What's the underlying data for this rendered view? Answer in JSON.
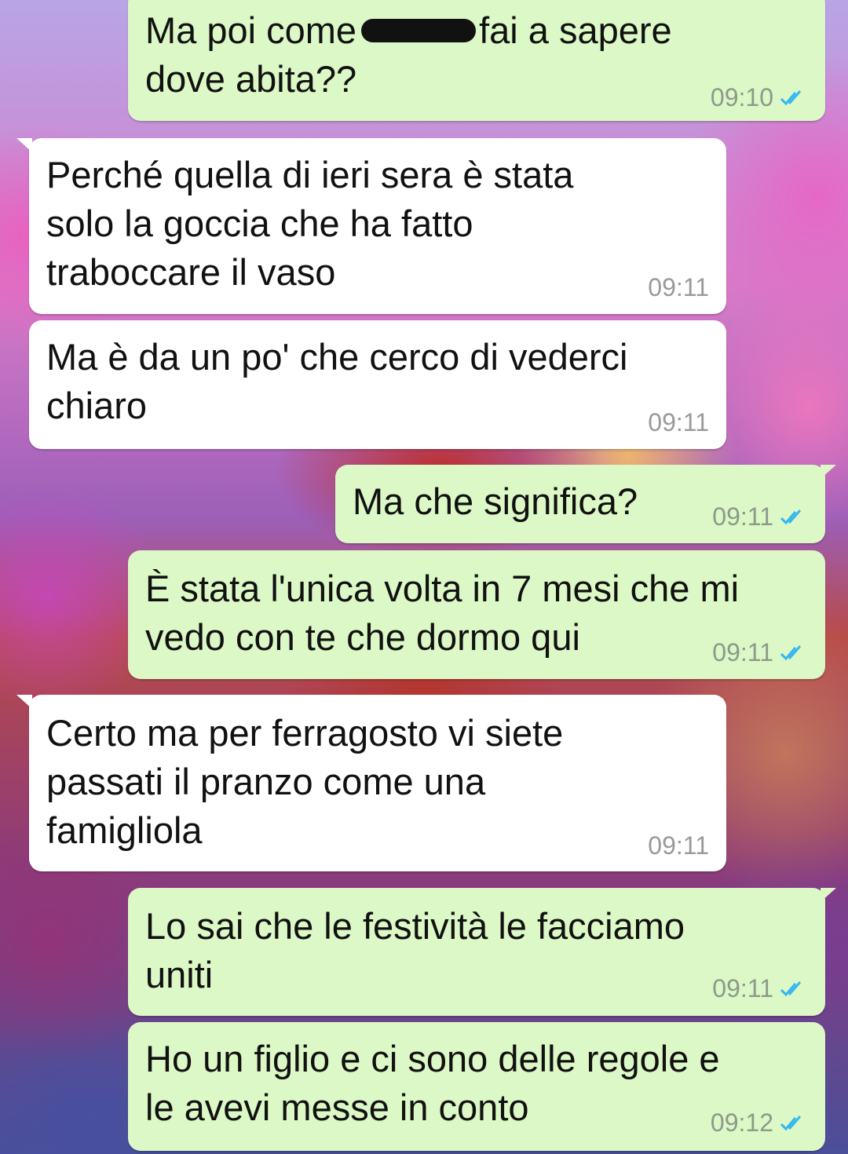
{
  "colors": {
    "outgoing_bubble": "#dcf8c6",
    "incoming_bubble": "#ffffff",
    "read_tick": "#34b7f1",
    "time_text": "#8c9a8a"
  },
  "messages": [
    {
      "direction": "outgoing",
      "part1": "Ma poi come",
      "redacted": true,
      "part2": "fai a sapere",
      "line2": "dove abita??",
      "time": "09:10",
      "status": "read"
    },
    {
      "direction": "incoming",
      "text": "Perché quella di ieri sera è stata\nsolo la goccia che ha fatto\ntraboccare il vaso",
      "time": "09:11"
    },
    {
      "direction": "incoming",
      "text": "Ma è da un po' che cerco di vederci\nchiaro",
      "time": "09:11"
    },
    {
      "direction": "outgoing",
      "text": "Ma che significa?",
      "time": "09:11",
      "status": "read"
    },
    {
      "direction": "outgoing",
      "text": "È stata l'unica volta in 7 mesi che mi\nvedo con te che dormo qui",
      "time": "09:11",
      "status": "read"
    },
    {
      "direction": "incoming",
      "text": "Certo ma per ferragosto vi siete\npassati il pranzo come una\nfamigliola",
      "time": "09:11"
    },
    {
      "direction": "outgoing",
      "text": "Lo sai che le festività le facciamo\nuniti",
      "time": "09:11",
      "status": "read"
    },
    {
      "direction": "outgoing",
      "text": "Ho un figlio e ci sono delle regole e\nle avevi messe in conto",
      "time": "09:12",
      "status": "read"
    }
  ]
}
